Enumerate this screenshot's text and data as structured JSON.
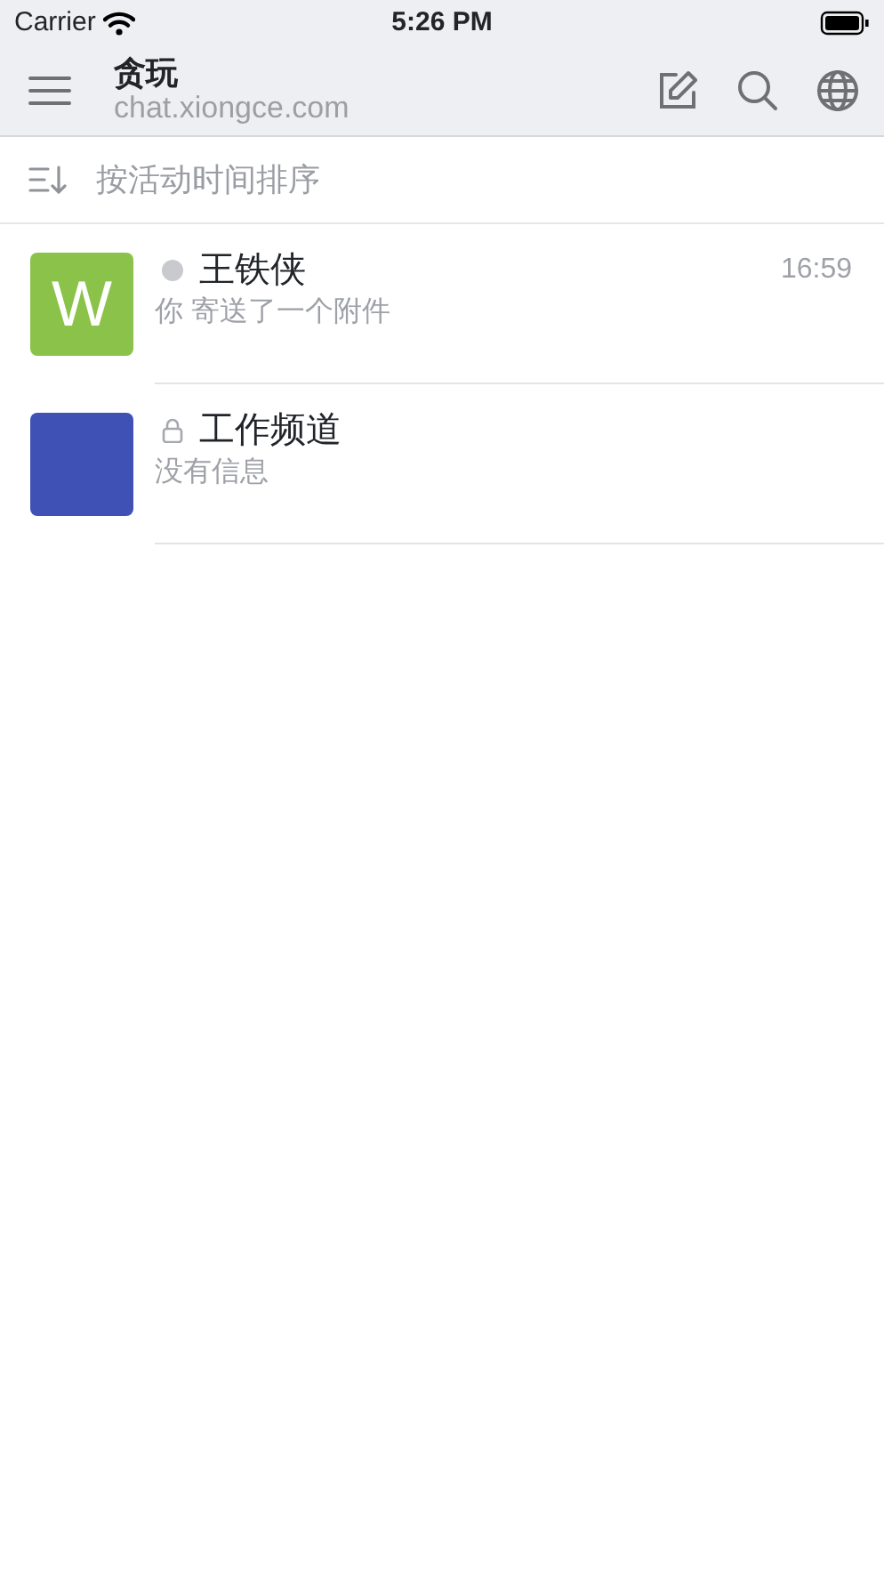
{
  "status_bar": {
    "carrier": "Carrier",
    "time": "5:26 PM"
  },
  "nav_bar": {
    "title": "贪玩",
    "subtitle": "chat.xiongce.com"
  },
  "sort": {
    "label": "按活动时间排序"
  },
  "channels": [
    {
      "kind": "direct",
      "name": "王铁侠",
      "preview": "你 寄送了一个附件",
      "time": "16:59",
      "avatar_letter": "W",
      "color": "#8bc34a"
    },
    {
      "kind": "private",
      "name": "工作频道",
      "preview": "没有信息",
      "color": "#3f51b5"
    }
  ]
}
